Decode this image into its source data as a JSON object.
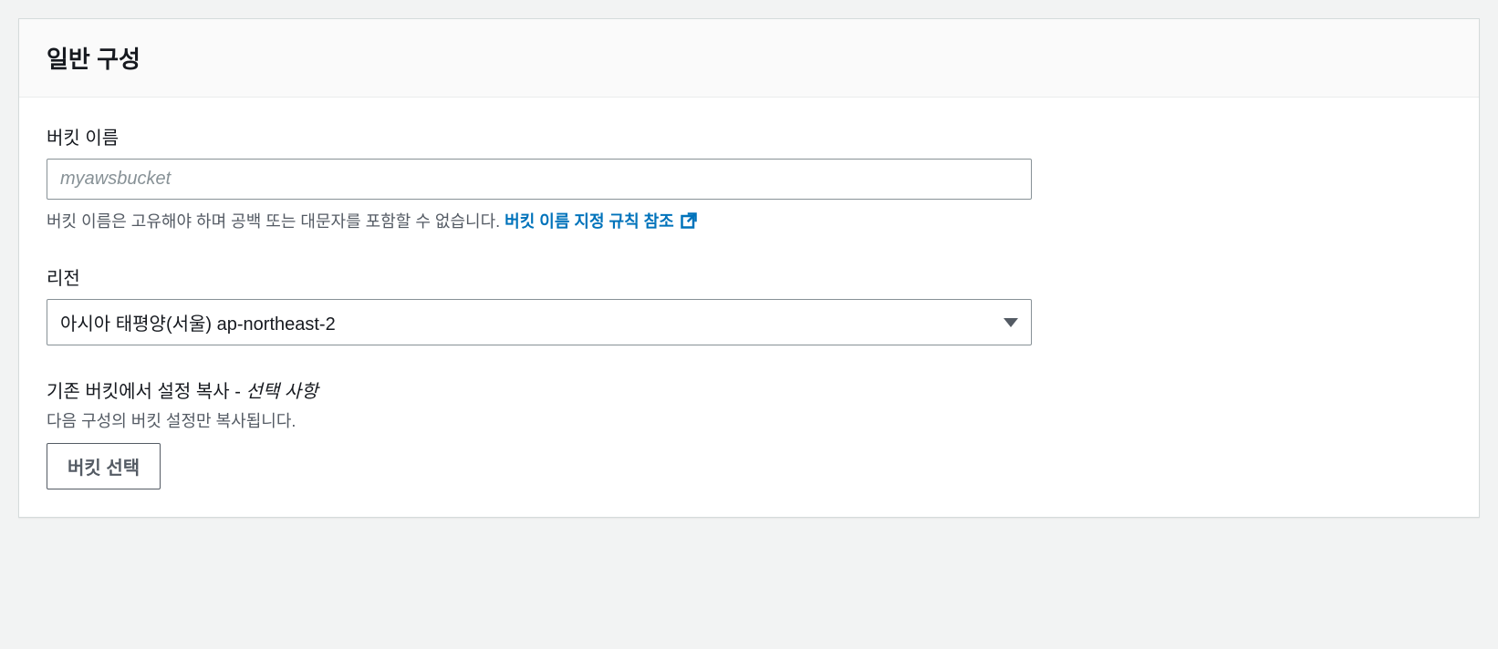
{
  "panel": {
    "title": "일반 구성"
  },
  "bucketName": {
    "label": "버킷 이름",
    "placeholder": "myawsbucket",
    "helpText": "버킷 이름은 고유해야 하며 공백 또는 대문자를 포함할 수 없습니다. ",
    "linkText": "버킷 이름 지정 규칙 참조"
  },
  "region": {
    "label": "리전",
    "value": "아시아 태평양(서울) ap-northeast-2"
  },
  "copySettings": {
    "labelMain": "기존 버킷에서 설정 복사 - ",
    "labelOptional": "선택 사항",
    "description": "다음 구성의 버킷 설정만 복사됩니다.",
    "buttonLabel": "버킷 선택"
  }
}
